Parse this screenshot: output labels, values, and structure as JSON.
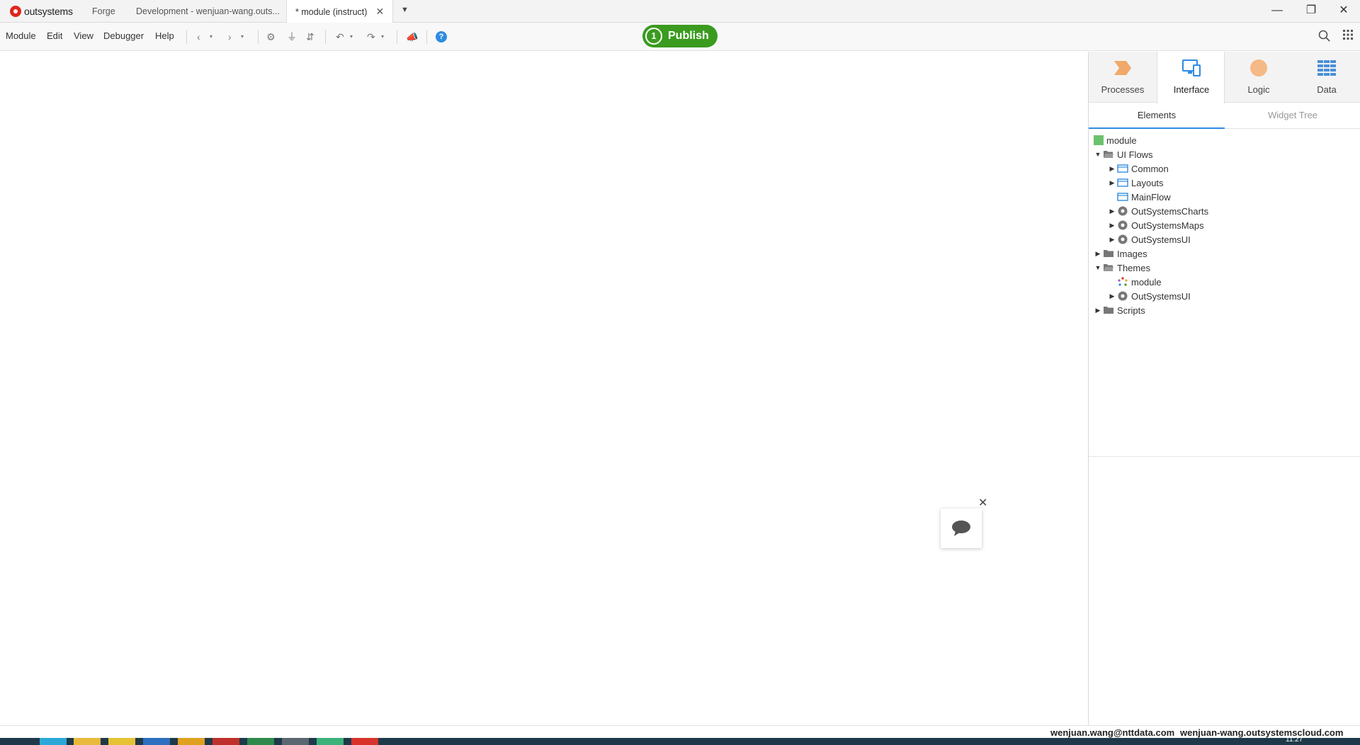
{
  "titlebar": {
    "brand": "outsystems",
    "tabs": [
      "Forge",
      "Development - wenjuan-wang.outs...",
      "* module (instruct)"
    ],
    "active_tab_close": "✕",
    "tabs_dropdown": "▼",
    "window_controls": [
      "—",
      "❐",
      "✕"
    ]
  },
  "toolbar": {
    "menu": [
      "Module",
      "Edit",
      "View",
      "Debugger",
      "Help"
    ],
    "publish_count": "1",
    "publish_label": "Publish",
    "help": "?"
  },
  "panel": {
    "tabs": [
      "Processes",
      "Interface",
      "Logic",
      "Data"
    ],
    "active_tab": "Interface",
    "subtabs": [
      "Elements",
      "Widget Tree"
    ],
    "active_subtab": "Elements",
    "tree": [
      {
        "label": "module",
        "icon": "module-icon",
        "caret": "",
        "level": 0
      },
      {
        "label": "UI Flows",
        "icon": "folder-open-icon",
        "caret": "▼",
        "level": 1
      },
      {
        "label": "Common",
        "icon": "flow-icon",
        "caret": "▶",
        "level": 2
      },
      {
        "label": "Layouts",
        "icon": "flow-icon",
        "caret": "▶",
        "level": 2
      },
      {
        "label": "MainFlow",
        "icon": "flow-icon",
        "caret": "",
        "level": 2
      },
      {
        "label": "OutSystemsCharts",
        "icon": "reference-icon",
        "caret": "▶",
        "level": 2
      },
      {
        "label": "OutSystemsMaps",
        "icon": "reference-icon",
        "caret": "▶",
        "level": 2
      },
      {
        "label": "OutSystemsUI",
        "icon": "reference-icon",
        "caret": "▶",
        "level": 2
      },
      {
        "label": "Images",
        "icon": "folder-icon",
        "caret": "▶",
        "level": 1
      },
      {
        "label": "Themes",
        "icon": "folder-open-icon",
        "caret": "▼",
        "level": 1
      },
      {
        "label": "module",
        "icon": "theme-icon",
        "caret": "",
        "level": 2
      },
      {
        "label": "OutSystemsUI",
        "icon": "reference-icon",
        "caret": "▶",
        "level": 2
      },
      {
        "label": "Scripts",
        "icon": "folder-icon",
        "caret": "▶",
        "level": 1
      }
    ]
  },
  "canvas": {
    "chat_close": "✕"
  },
  "statusbar": {
    "user": "wenjuan.wang@nttdata.com",
    "server": "wenjuan-wang.outsystemscloud.com"
  },
  "taskbar": {
    "clock": "11:27"
  },
  "colors": {
    "publish": "#3a9b1f",
    "accent": "#2f8be0",
    "processes": "#f0a96b",
    "logic": "#f5b985",
    "data": "#4a90d9"
  }
}
